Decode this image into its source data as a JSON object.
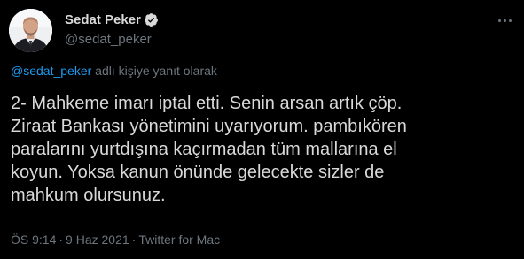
{
  "tweet": {
    "author": {
      "display_name": "Sedat Peker",
      "handle": "@sedat_peker",
      "verified": true,
      "avatar_icon": "profile-photo"
    },
    "more_icon": "more-horizontal-icon",
    "reply_context": {
      "mention": "@sedat_peker",
      "suffix": " adlı kişiye yanıt olarak"
    },
    "text_lines": [
      "2- Mahkeme imarı iptal etti. Senin arsan artık çöp.",
      "Ziraat Bankası yönetimini uyarıyorum. pambıkören",
      "paralarını yurtdışına kaçırmadan tüm mallarına el",
      "koyun. Yoksa kanun önünde gelecekte sizler de",
      "mahkum olursunuz."
    ],
    "meta": {
      "time": "ÖS 9:14",
      "separator": "·",
      "date": "9 Haz 2021",
      "source": "Twitter for Mac"
    }
  },
  "colors": {
    "background": "#000000",
    "text": "#d9d9d9",
    "secondary": "#6e767d",
    "link": "#1d9bf0",
    "verified_badge": "#d9d9d9"
  }
}
